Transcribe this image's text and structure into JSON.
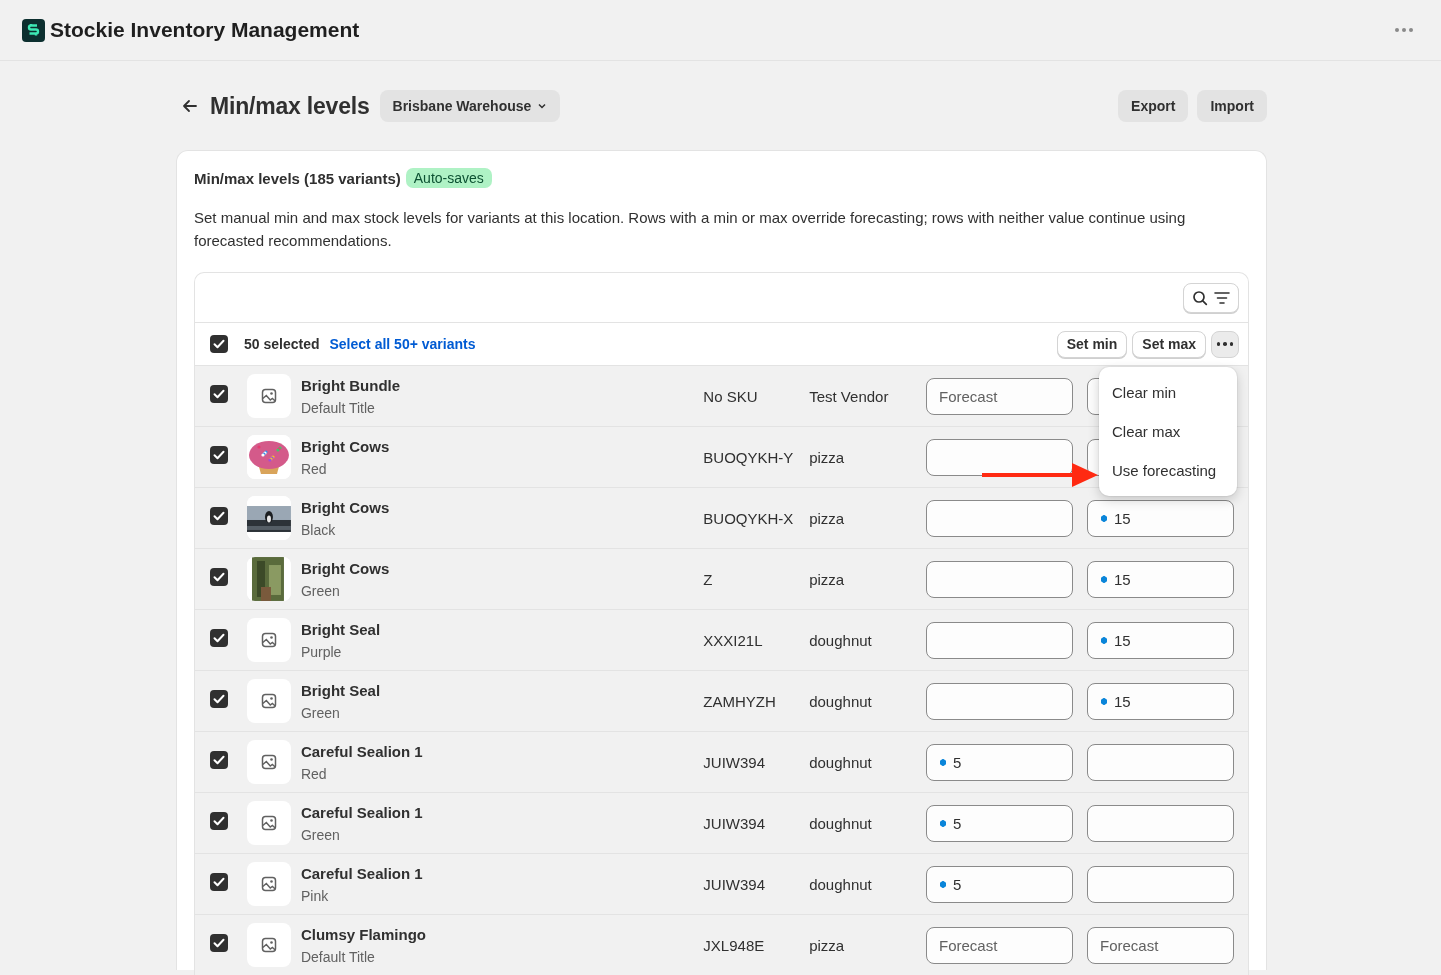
{
  "app": {
    "title": "Stockie Inventory Management"
  },
  "header": {
    "title": "Min/max levels",
    "location": "Brisbane Warehouse",
    "actions": [
      "Export",
      "Import"
    ]
  },
  "card": {
    "title": "Min/max levels (185 variants)",
    "badge": "Auto-saves",
    "description": "Set manual min and max stock levels for variants at this location. Rows with a min or max override forecasting; rows with neither value continue using forecasted recommendations."
  },
  "bulk": {
    "checked": true,
    "count": "50 selected",
    "select_all": "Select all 50+ variants",
    "actions": [
      "Set min",
      "Set max"
    ]
  },
  "menu": {
    "open": true,
    "items": [
      "Clear min",
      "Clear max",
      "Use forecasting"
    ]
  },
  "rows": [
    {
      "checked": true,
      "thumb": {
        "kind": "placeholder"
      },
      "name": "Bright Bundle",
      "variant": "Default Title",
      "sku": "No SKU",
      "vendor": "Test Vendor",
      "min": {
        "placeholder": "Forecast"
      },
      "max": {
        "override": false
      }
    },
    {
      "checked": true,
      "name": "Bright Cows",
      "variant": "Red",
      "sku": "BUOQYKH-Y",
      "vendor": "pizza",
      "min": {
        "override": false
      },
      "max": {
        "override": false
      }
    },
    {
      "checked": true,
      "name": "Bright Cows",
      "variant": "Black",
      "sku": "BUOQYKH-X",
      "vendor": "pizza",
      "min": {
        "override": false
      },
      "max": {
        "value": "15",
        "override": true
      }
    },
    {
      "checked": true,
      "name": "Bright Cows",
      "variant": "Green",
      "sku": "Z",
      "vendor": "pizza",
      "min": {
        "override": false
      },
      "max": {
        "value": "15",
        "override": true
      }
    },
    {
      "checked": true,
      "thumb": {
        "kind": "placeholder"
      },
      "name": "Bright Seal",
      "variant": "Purple",
      "sku": "XXXI21L",
      "vendor": "doughnut",
      "min": {
        "override": false
      },
      "max": {
        "value": "15",
        "override": true
      }
    },
    {
      "checked": true,
      "thumb": {
        "kind": "placeholder"
      },
      "name": "Bright Seal",
      "variant": "Green",
      "sku": "ZAMHYZH",
      "vendor": "doughnut",
      "min": {
        "override": false
      },
      "max": {
        "value": "15",
        "override": true
      }
    },
    {
      "checked": true,
      "thumb": {
        "kind": "placeholder"
      },
      "name": "Careful Sealion 1",
      "variant": "Red",
      "sku": "JUIW394",
      "vendor": "doughnut",
      "min": {
        "value": "5",
        "override": true
      },
      "max": {
        "override": false
      }
    },
    {
      "checked": true,
      "thumb": {
        "kind": "placeholder"
      },
      "name": "Careful Sealion 1",
      "variant": "Green",
      "sku": "JUIW394",
      "vendor": "doughnut",
      "min": {
        "value": "5",
        "override": true
      },
      "max": {
        "override": false
      }
    },
    {
      "checked": true,
      "thumb": {
        "kind": "placeholder"
      },
      "name": "Careful Sealion 1",
      "variant": "Pink",
      "sku": "JUIW394",
      "vendor": "doughnut",
      "min": {
        "value": "5",
        "override": true
      },
      "max": {
        "override": false
      }
    },
    {
      "checked": true,
      "thumb": {
        "kind": "placeholder"
      },
      "name": "Clumsy Flamingo",
      "variant": "Default Title",
      "sku": "JXL948E",
      "vendor": "pizza",
      "min": {
        "placeholder": "Forecast"
      },
      "max": {
        "placeholder": "Forecast"
      }
    }
  ]
}
